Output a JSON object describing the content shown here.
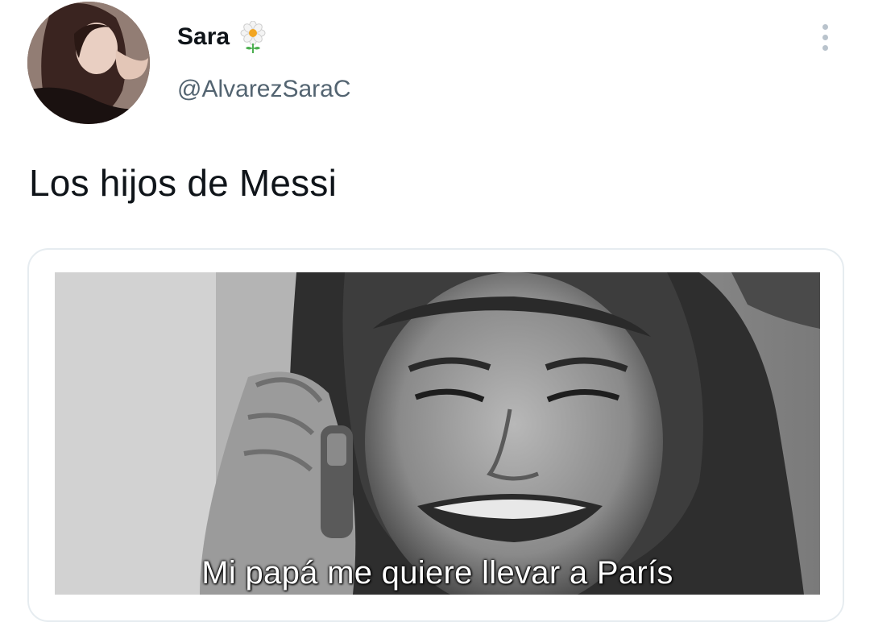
{
  "tweet": {
    "author": {
      "display_name": "Sara",
      "name_emoji": "flower-icon",
      "handle": "@AlvarezSaraC"
    },
    "text": "Los hijos de Messi",
    "media": {
      "caption": "Mi papá me quiere llevar a París"
    }
  },
  "colors": {
    "text_primary": "#0f1419",
    "text_secondary": "#536471",
    "card_border": "#e6ecf0",
    "more_dots": "#b9c3cc"
  }
}
